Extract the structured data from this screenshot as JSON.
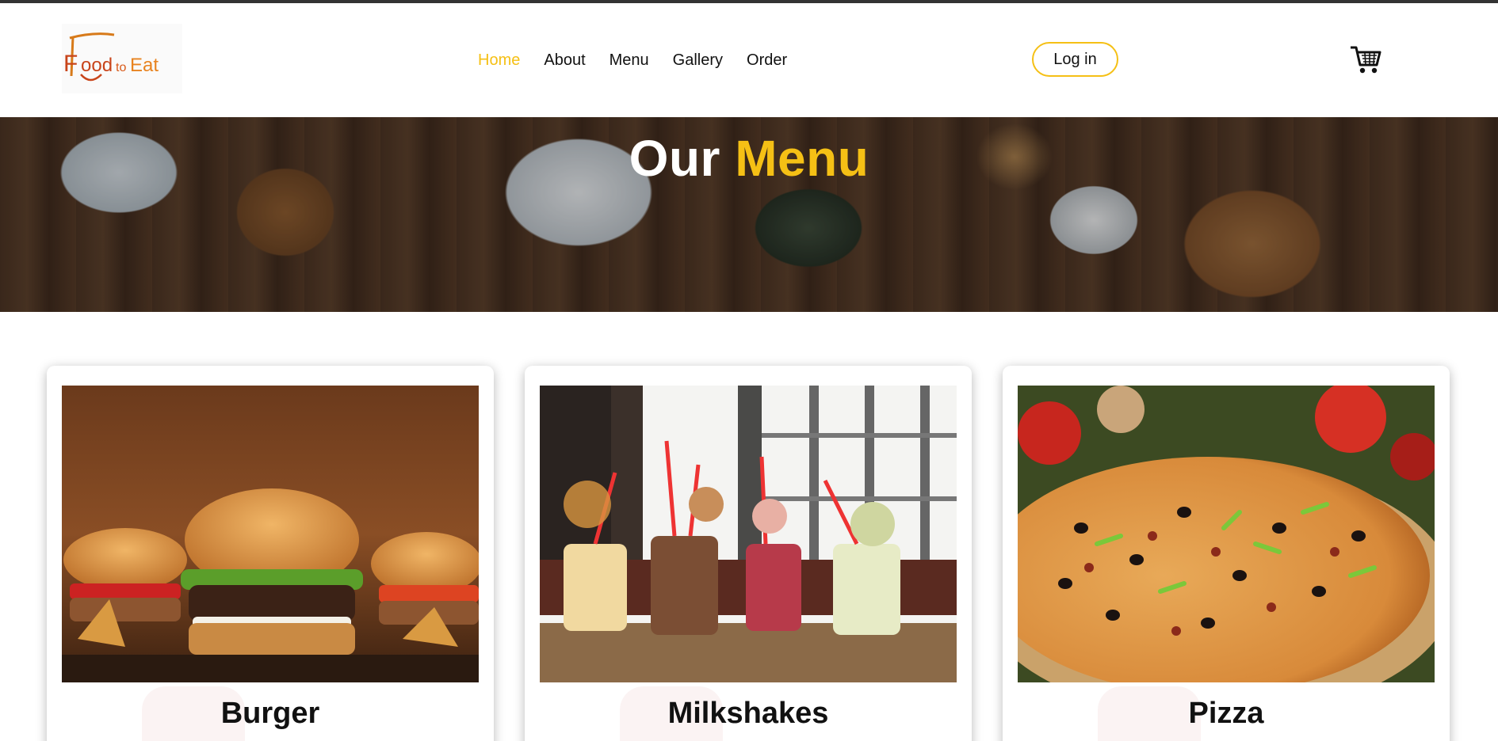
{
  "brand": {
    "logo_text_main": "ood",
    "logo_text_to": "to",
    "logo_text_eat": "Eat",
    "logo_initial": "F",
    "accent_color": "#f5c015"
  },
  "nav": {
    "items": [
      {
        "label": "Home",
        "active": true
      },
      {
        "label": "About",
        "active": false
      },
      {
        "label": "Menu",
        "active": false
      },
      {
        "label": "Gallery",
        "active": false
      },
      {
        "label": "Order",
        "active": false
      }
    ]
  },
  "header": {
    "login_label": "Log in",
    "cart_icon": "cart-icon"
  },
  "hero": {
    "title_part1": "Our",
    "title_part2": "Menu"
  },
  "menu": {
    "cards": [
      {
        "title": "Burger",
        "image": "burger-photo"
      },
      {
        "title": "Milkshakes",
        "image": "milkshakes-photo"
      },
      {
        "title": "Pizza",
        "image": "pizza-photo"
      }
    ]
  }
}
